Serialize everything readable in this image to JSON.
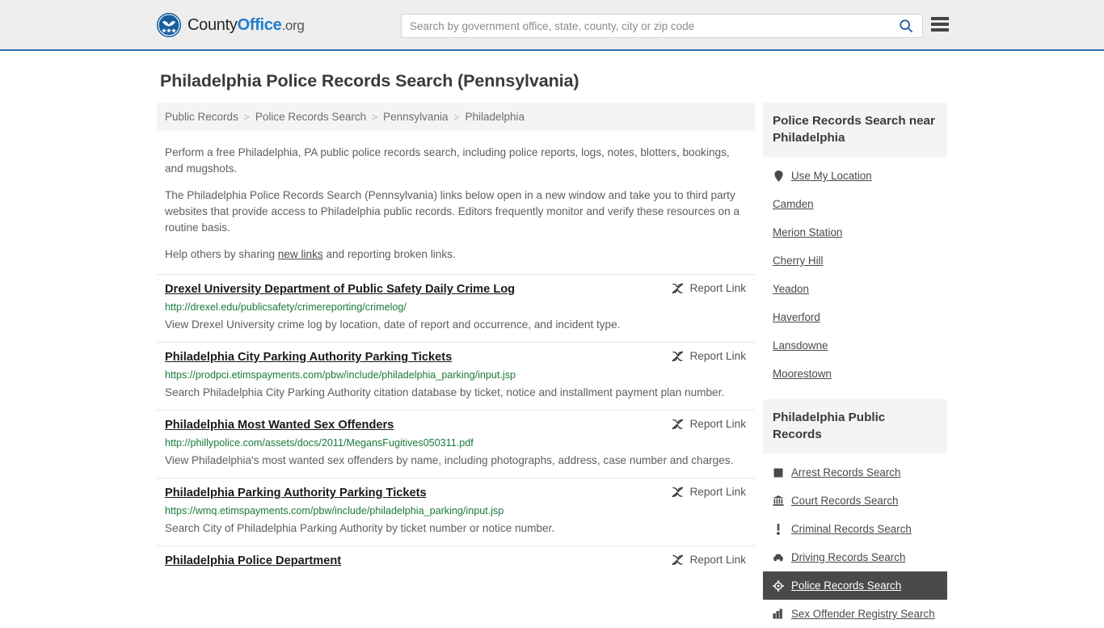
{
  "header": {
    "brand": {
      "part1": "County",
      "part2": "Office",
      "part3": ".org",
      "icon": "eagle-shield-logo"
    },
    "search": {
      "placeholder": "Search by government office, state, county, city or zip code",
      "value": "",
      "button_icon": "search-icon"
    },
    "menu_icon": "hamburger-menu-icon",
    "accent_color": "#2b6cab"
  },
  "page": {
    "title": "Philadelphia Police Records Search (Pennsylvania)"
  },
  "breadcrumb": {
    "separator": ">",
    "items": [
      {
        "label": "Public Records",
        "current": false
      },
      {
        "label": "Police Records Search",
        "current": false
      },
      {
        "label": "Pennsylvania",
        "current": false
      },
      {
        "label": "Philadelphia",
        "current": true
      }
    ]
  },
  "intro": {
    "paragraph1": "Perform a free Philadelphia, PA public police records search, including police reports, logs, notes, blotters, bookings, and mugshots.",
    "paragraph2": "The Philadelphia Police Records Search (Pennsylvania) links below open in a new window and take you to third party websites that provide access to Philadelphia public records. Editors frequently monitor and verify these resources on a routine basis.",
    "paragraph3_before": "Help others by sharing ",
    "paragraph3_link": "new links",
    "paragraph3_after": " and reporting broken links."
  },
  "results": {
    "report_label": "Report Link",
    "report_icon": "unlink-icon",
    "items": [
      {
        "title": "Drexel University Department of Public Safety Daily Crime Log",
        "url": "http://drexel.edu/publicsafety/crimereporting/crimelog/",
        "description": "View Drexel University crime log by location, date of report and occurrence, and incident type."
      },
      {
        "title": "Philadelphia City Parking Authority Parking Tickets",
        "url": "https://prodpci.etimspayments.com/pbw/include/philadelphia_parking/input.jsp",
        "description": "Search Philadelphia City Parking Authority citation database by ticket, notice and installment payment plan number."
      },
      {
        "title": "Philadelphia Most Wanted Sex Offenders",
        "url": "http://phillypolice.com/assets/docs/2011/MegansFugitives050311.pdf",
        "description": "View Philadelphia's most wanted sex offenders by name, including photographs, address, case number and charges."
      },
      {
        "title": "Philadelphia Parking Authority Parking Tickets",
        "url": "https://wmq.etimspayments.com/pbw/include/philadelphia_parking/input.jsp",
        "description": "Search City of Philadelphia Parking Authority by ticket number or notice number."
      },
      {
        "title": "Philadelphia Police Department",
        "url": "",
        "description": ""
      }
    ]
  },
  "sidebar": {
    "nearby": {
      "heading": "Police Records Search near Philadelphia",
      "items": [
        {
          "label": "Use My Location",
          "icon": "location-pin-icon"
        },
        {
          "label": "Camden",
          "icon": ""
        },
        {
          "label": "Merion Station",
          "icon": ""
        },
        {
          "label": "Cherry Hill",
          "icon": ""
        },
        {
          "label": "Yeadon",
          "icon": ""
        },
        {
          "label": "Haverford",
          "icon": ""
        },
        {
          "label": "Lansdowne",
          "icon": ""
        },
        {
          "label": "Moorestown",
          "icon": ""
        }
      ]
    },
    "public_records": {
      "heading": "Philadelphia Public Records",
      "items": [
        {
          "label": "Arrest Records Search",
          "icon": "fingerprint-square-icon",
          "active": false
        },
        {
          "label": "Court Records Search",
          "icon": "courthouse-icon",
          "active": false
        },
        {
          "label": "Criminal Records Search",
          "icon": "exclamation-icon",
          "active": false
        },
        {
          "label": "Driving Records Search",
          "icon": "car-icon",
          "active": false
        },
        {
          "label": "Police Records Search",
          "icon": "police-badge-icon",
          "active": true
        },
        {
          "label": "Sex Offender Registry Search",
          "icon": "buildings-icon",
          "active": false
        }
      ]
    },
    "active_bg_color": "#4a4a4a"
  }
}
